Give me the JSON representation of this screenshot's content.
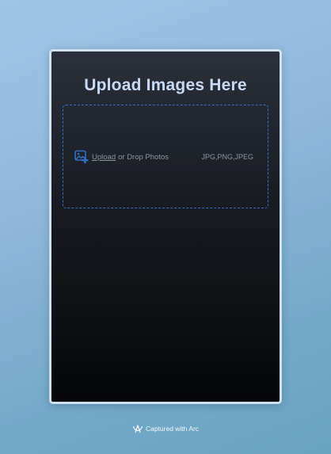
{
  "app": {
    "title": "Upload Images Here"
  },
  "dropzone": {
    "upload_link": "Upload",
    "drop_text": "or Drop Photos",
    "formats": "JPG,PNG,JPEG",
    "icon": "image-add-icon"
  },
  "footer": {
    "captured_text": "Captured with Arc",
    "icon": "arc-logo-icon"
  },
  "colors": {
    "title": "#c7d9f5",
    "accent": "#2f6fc4",
    "muted_text": "#8e949c",
    "panel_top": "#2a2f39",
    "panel_bottom": "#050607"
  }
}
